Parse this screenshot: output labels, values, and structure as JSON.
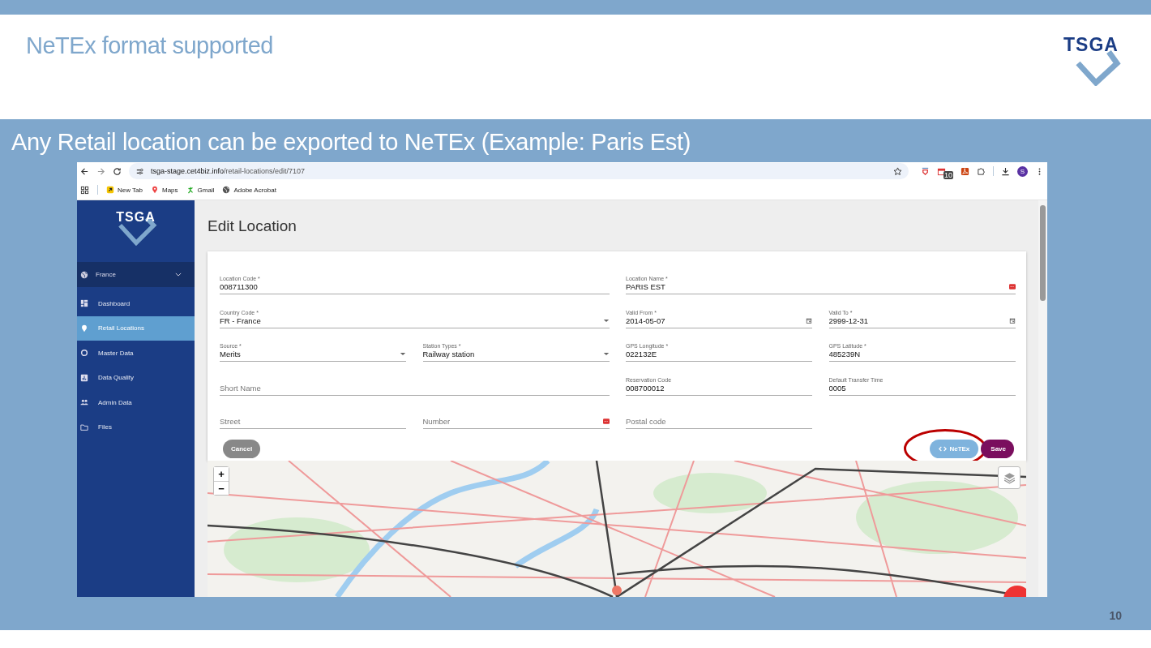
{
  "slide": {
    "title": "NeTEx format supported",
    "logo": "TSGA",
    "subtitle": "Any Retail location can be exported to NeTEx (Example: Paris Est)",
    "page_number": "10"
  },
  "browser": {
    "url_host": "tsga-stage.cet4biz.info",
    "url_path": "/retail-locations/edit/7107",
    "extension_badge": "10",
    "profile_initial": "S",
    "bookmarks": [
      {
        "label": "New Tab"
      },
      {
        "label": "Maps"
      },
      {
        "label": "Gmail"
      },
      {
        "label": "Adobe Acrobat"
      }
    ]
  },
  "app": {
    "logo": "TSGA",
    "country": {
      "label": "France",
      "expanded": false
    },
    "nav": [
      {
        "label": "Dashboard",
        "selected": false
      },
      {
        "label": "Retail Locations",
        "selected": true
      },
      {
        "label": "Master Data",
        "selected": false
      },
      {
        "label": "Data Quality",
        "selected": false
      },
      {
        "label": "Admin Data",
        "selected": false
      },
      {
        "label": "Files",
        "selected": false
      }
    ],
    "page_title": "Edit Location",
    "fields": [
      {
        "label": "Location Code *",
        "value": "008711300",
        "kind": "text"
      },
      {
        "label": "Location Name *",
        "value": "PARIS EST",
        "kind": "text",
        "autofill": true
      },
      {
        "label": "Country Code *",
        "value": "FR - France",
        "kind": "select"
      },
      {
        "label": "Valid From *",
        "value": "2014-05-07",
        "kind": "date"
      },
      {
        "label": "Valid To *",
        "value": "2999-12-31",
        "kind": "date"
      },
      {
        "label": "Source *",
        "value": "Merits",
        "kind": "select"
      },
      {
        "label": "Station Types *",
        "value": "Railway station",
        "kind": "select"
      },
      {
        "label": "GPS Longitude *",
        "value": "022132E",
        "kind": "text"
      },
      {
        "label": "GPS Latitude *",
        "value": "485239N",
        "kind": "text"
      },
      {
        "placeholder": "Short Name",
        "kind": "text"
      },
      {
        "label": "Reservation Code",
        "value": "008700012",
        "kind": "text"
      },
      {
        "label": "Default Transfer Time",
        "value": "0005",
        "kind": "text"
      },
      {
        "placeholder": "Street",
        "kind": "text"
      },
      {
        "placeholder": "Number",
        "kind": "text",
        "autofill": true
      },
      {
        "placeholder": "Postal code",
        "kind": "text"
      }
    ],
    "buttons": [
      {
        "label": "Cancel",
        "kind": "cancel"
      },
      {
        "label": "NeTEx",
        "kind": "netex",
        "highlighted": true
      },
      {
        "label": "Save",
        "kind": "save"
      }
    ],
    "map": {
      "zoom_in": "+",
      "zoom_out": "−"
    }
  }
}
